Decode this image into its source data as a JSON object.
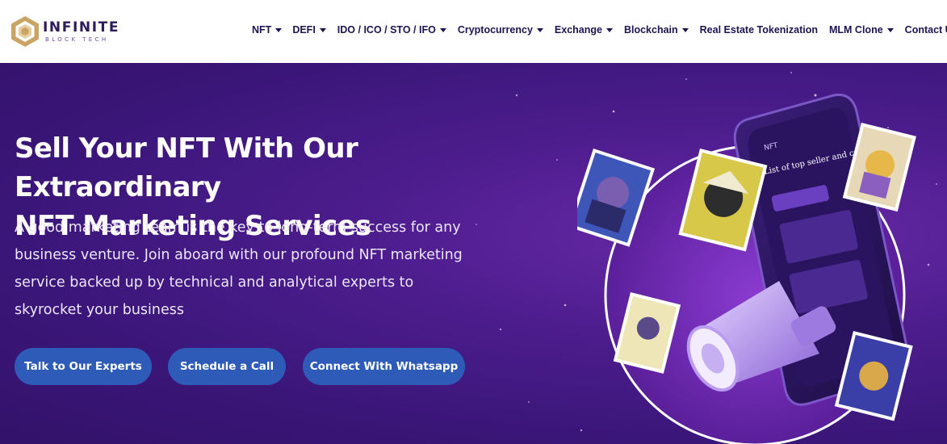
{
  "brand": {
    "name": "INFINITE",
    "tagline": "BLOCK TECH"
  },
  "nav": {
    "items": [
      {
        "label": "NFT",
        "dropdown": true
      },
      {
        "label": "DEFI",
        "dropdown": true
      },
      {
        "label": "IDO / ICO / STO / IFO",
        "dropdown": true
      },
      {
        "label": "Cryptocurrency",
        "dropdown": true
      },
      {
        "label": "Exchange",
        "dropdown": true
      },
      {
        "label": "Blockchain",
        "dropdown": true
      },
      {
        "label": "Real Estate Tokenization",
        "dropdown": false
      },
      {
        "label": "MLM Clone",
        "dropdown": true
      },
      {
        "label": "Contact US",
        "dropdown": true
      }
    ]
  },
  "hero": {
    "title_line1": "Sell Your NFT With Our Extraordinary",
    "title_line2": "NFT Marketing Services",
    "description": "A good marketing team is the key to long-term success for any business venture. Join aboard with our profound NFT marketing service backed up by technical and analytical experts to skyrocket your business",
    "buttons": {
      "experts": "Talk to Our Experts",
      "schedule": "Schedule a Call",
      "whatsapp": "Connect With Whatsapp"
    },
    "phone_screen": {
      "header": "NFT",
      "heading": "List of top seller and creator"
    }
  },
  "colors": {
    "nav_text": "#1f1450",
    "hero_bg": "#3a1678",
    "button_bg": "#2f5bb8",
    "logo_gold": "#c9a464"
  }
}
